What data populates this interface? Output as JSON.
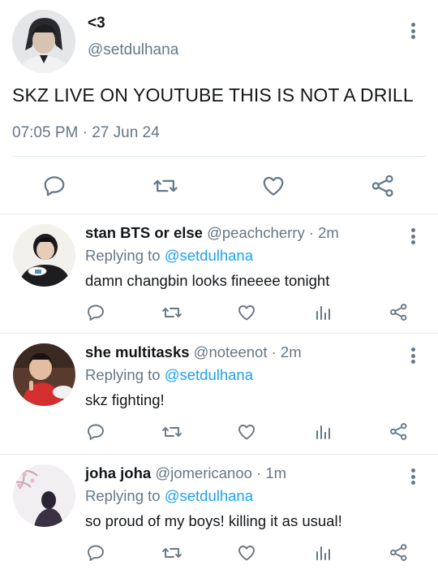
{
  "main_tweet": {
    "display_name": "<3",
    "handle": "@setdulhana",
    "text": "SKZ LIVE ON YOUTUBE THIS IS NOT A DRILL",
    "timestamp": "07:05 PM · 27 Jun 24",
    "actions": [
      "reply-icon",
      "retweet-icon",
      "like-icon",
      "share-icon"
    ]
  },
  "replies": [
    {
      "display_name": "stan BTS or else",
      "handle_meta": "@peachcherry · 2m",
      "replying_prefix": "Replying to",
      "replying_to": "@setdulhana",
      "text": "damn changbin looks fineeee tonight"
    },
    {
      "display_name": "she multitasks",
      "handle_meta": "@noteenot · 2m",
      "replying_prefix": "Replying to",
      "replying_to": "@setdulhana",
      "text": "skz fighting!"
    },
    {
      "display_name": "joha joha",
      "handle_meta": "@jomericanoo · 1m",
      "replying_prefix": "Replying to",
      "replying_to": "@setdulhana",
      "text": "so proud of my boys! killing it as usual!"
    }
  ],
  "reply_actions": [
    "reply-icon",
    "retweet-icon",
    "like-icon",
    "analytics-icon",
    "share-icon"
  ],
  "colors": {
    "text": "#14171a",
    "muted": "#657786",
    "link": "#1da1f2",
    "divider": "#e6ecf0"
  }
}
